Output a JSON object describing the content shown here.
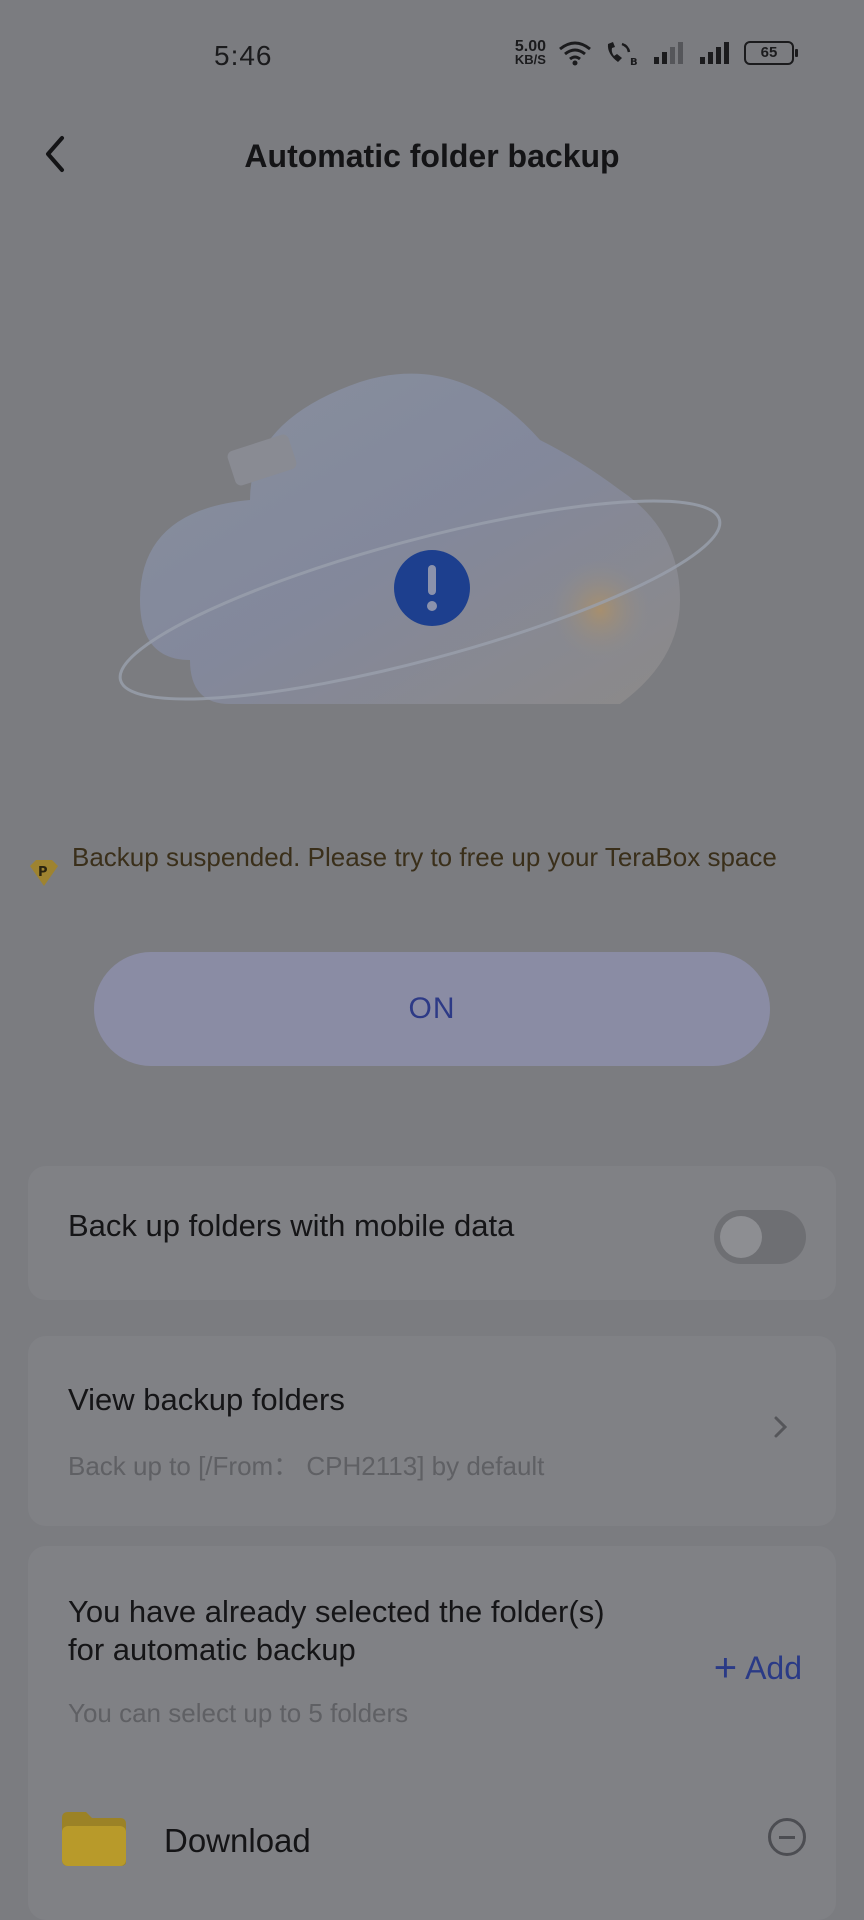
{
  "status_bar": {
    "time": "5:46",
    "net_speed_value": "5.00",
    "net_speed_unit": "KB/S",
    "battery": "65"
  },
  "header": {
    "title": "Automatic folder backup",
    "back_icon": "chevron-left-icon"
  },
  "hero": {
    "illustration": "cloud-warning-illustration",
    "alert_icon": "exclamation-icon"
  },
  "warning": {
    "icon": "premium-badge-icon",
    "text": "Backup suspended. Please try to free up your TeraBox space"
  },
  "main_button": {
    "label": "ON"
  },
  "mobile_data": {
    "label": "Back up folders with mobile data",
    "enabled": false
  },
  "backup_folders": {
    "title": "View backup folders",
    "subtitle": "Back up to [/From： CPH2113] by default"
  },
  "selected": {
    "title_line1": "You have already selected the folder(s)",
    "title_line2": "for automatic backup",
    "hint": "You can select up to 5 folders",
    "add_label": "Add",
    "add_icon": "plus-icon",
    "folders": [
      {
        "name": "Download",
        "icon": "folder-icon"
      }
    ]
  },
  "colors": {
    "overlay_bg": "#7b7c80",
    "accent": "#2a3a86",
    "folder_yellow": "#b89a2a"
  }
}
